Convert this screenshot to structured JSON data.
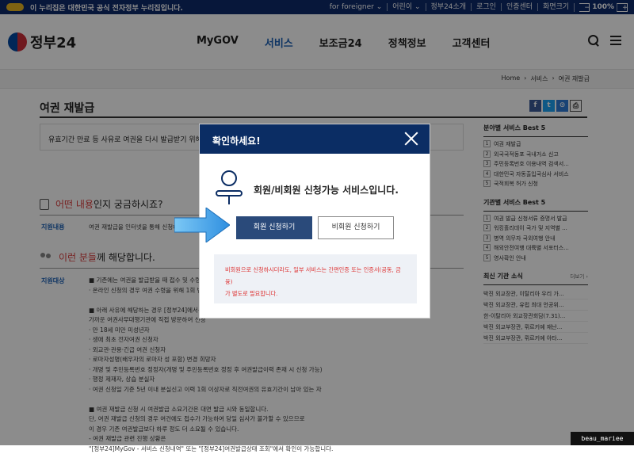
{
  "gov_banner": {
    "text": "이 누리집은 대한민국 공식 전자정부 누리집입니다.",
    "links": [
      "for foreigner ⌄",
      "어린이 ⌄",
      "정부24소개",
      "로그인",
      "인증센터",
      "화면크기"
    ],
    "zoom_minus": "−",
    "zoom_value": "100%",
    "zoom_plus": "+"
  },
  "header": {
    "logo_text": "정부24",
    "nav": [
      "MyGOV",
      "서비스",
      "보조금24",
      "정책정보",
      "고객센터"
    ],
    "active_nav": "서비스"
  },
  "breadcrumb": [
    "Home",
    "›",
    "서비스",
    "›",
    "여권 재발급"
  ],
  "page": {
    "title": "여권 재발급",
    "summary": "유효기간 만료 등 사유로 여권을 다시 발급받기 위해 ·"
  },
  "share_icons": [
    "f",
    "t",
    "⊙",
    "⎙"
  ],
  "section_what": {
    "highlight": "어떤 내용",
    "rest": "인지 궁금하시죠?"
  },
  "row_content": {
    "label": "지원내용",
    "text": "여권 재발급을 인터넷을 통해 신청하고"
  },
  "section_who": {
    "highlight": "이런 분들",
    "rest": "께 해당합니다."
  },
  "row_target": {
    "label": "지원대상"
  },
  "target_lines": [
    "■ 기존에는 여권을 발급받을 때 접수 및 수령을 위",
    "· 온라인 신청의 경우 여권 수령을 위해 1회 방문",
    "",
    "■ 아래 사유에 해당하는 경우 [정부24]에서는 신",
    "가까운 여권사무대행기관에 직접 방문하여 신청",
    "· 만 18세 미만 미성년자",
    "· 생애 최초 전자여권 신청자",
    "· 외교관·관용·긴급 여권 신청자",
    "· 로마자성명(배우자의 로마자 성 포함) 변경 희망자",
    "· 개명 및 주민등록번호 정정자(개명 및 주민등록번호 정정 후 여권발급이력 존재 시 신청 가능)",
    "· 행정 제재자, 상습 분실자",
    "· 여권 신청일 기준 5년 이내 분실신고 이력 1회 이상자로 직전여권의 유효기간이 남아 있는 자",
    "",
    "■ 여권 재발급 신청 시 여권발급 소요기간은 대면 발급 시와 동일합니다.",
    "단, 여권 재발급 신청의 경우 여건에도 접수가 가능하여 당일 심사가 불가할 수 있으므로",
    "이 경우 기존 여권발급보다 하루 정도 더 소요될 수 있습니다.",
    "- 여권 재발급 관련 진행 상황은",
    "\"[정부24]MyGov - 서비스 신청내역\" 또는 \"[정부24]여권발급상태 조회\"에서 확인이 가능합니다."
  ],
  "sidebar": {
    "best_field": {
      "title": "분야별 서비스 Best 5",
      "items": [
        "여권 재발급",
        "외국국적동포 국내거소 신고",
        "주민등록번호 이용내역 검색서...",
        "대한민국 자동출입국심사 서비스",
        "국적회복 허가 신청"
      ]
    },
    "best_org": {
      "title": "기관별 서비스 Best 5",
      "items": [
        "여권 발급 신청서류 증명서 발급",
        "워킹홀리데이 국가 및 지역별 ...",
        "병역 의무자 국외여행 안내",
        "해외안전여행 대륙별 서포터스...",
        "영사확인 안내"
      ]
    },
    "news": {
      "title": "최신 기관 소식",
      "more": "더보기 ›",
      "items": [
        "박진 외교장관, 이탈리아 우리 가...",
        "박진 외교장관, 유럽 최대 언공위...",
        "한-이탈리아 외교장관회담(7.31)...",
        "박진 외교부장관, 뤼르키예 재난...",
        "박진 외교부장관, 뤼르키예 아타..."
      ]
    }
  },
  "modal": {
    "title": "확인하세요!",
    "message": "회원/비회원 신청가능 서비스입니다.",
    "member_button": "회원 신청하기",
    "guest_button": "비회원 신청하기",
    "notice_line1": "비회원으로 신청하시더라도, 일부 서비스는 간편인증 또는 인증서(공동, 금융)",
    "notice_line2": "가 별도로 필요합니다."
  },
  "watermark": "beau_mariee",
  "colors": {
    "banner": "#0e2a6b",
    "modal_header": "#0b2d64",
    "primary_button": "#2a4a7a",
    "accent_red": "#d93b3b",
    "arrow": "#4aa8e8"
  }
}
